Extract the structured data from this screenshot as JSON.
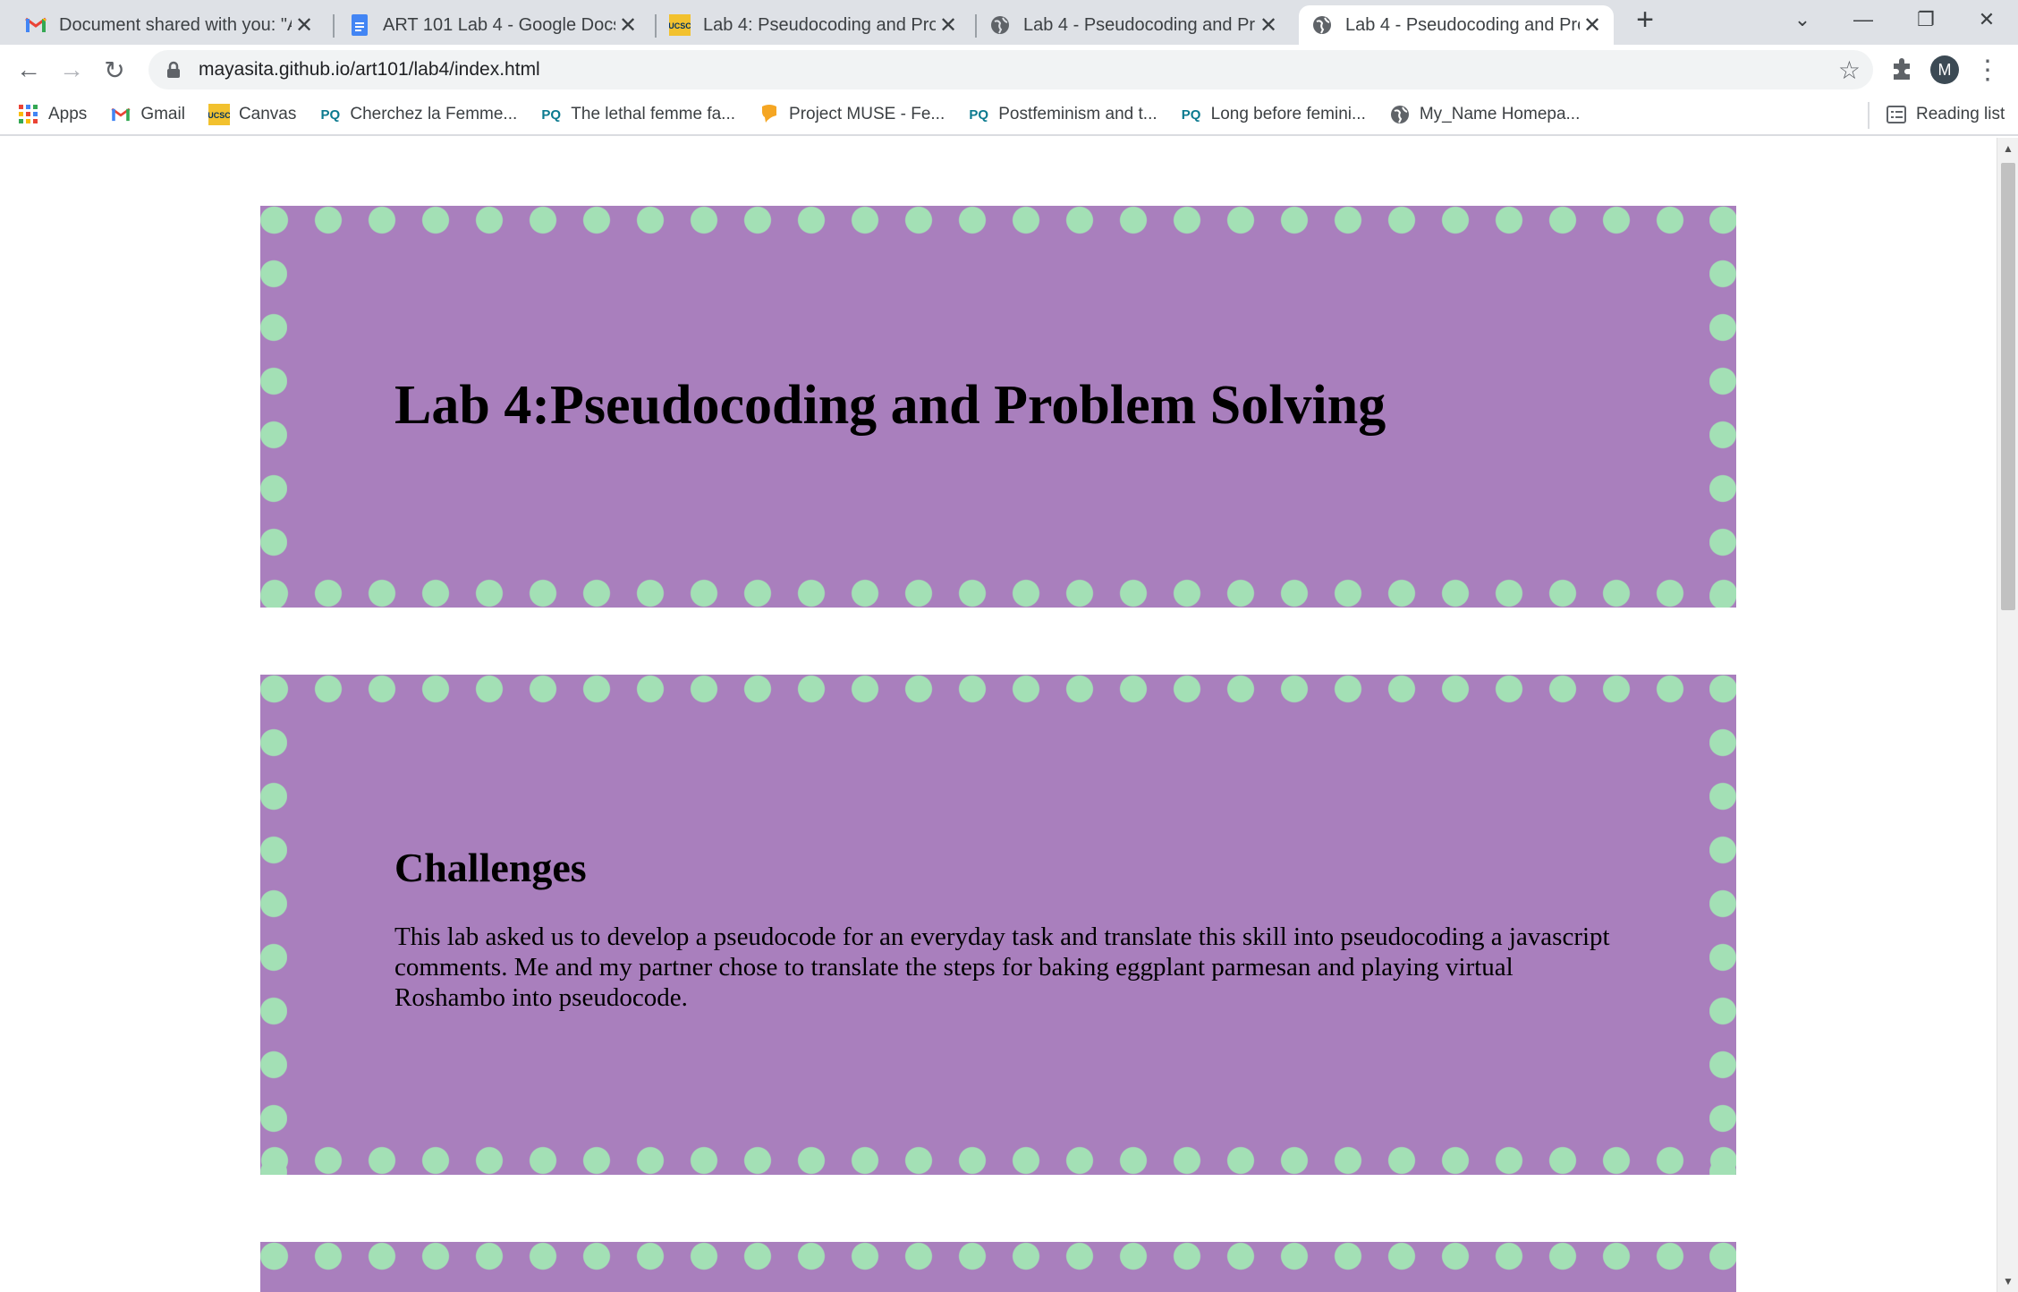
{
  "browser": {
    "tabs": [
      {
        "title": "Document shared with you: \"ART",
        "icon": "gmail-icon"
      },
      {
        "title": "ART 101 Lab 4 - Google Docs",
        "icon": "google-docs-icon"
      },
      {
        "title": "Lab 4: Pseudocoding and Problem",
        "icon": "ucsc-icon"
      },
      {
        "title": "Lab 4 - Pseudocoding and Proble",
        "icon": "globe-icon"
      },
      {
        "title": "Lab 4 - Pseudocoding and Proble",
        "icon": "globe-icon"
      }
    ],
    "active_tab": 4,
    "url": "mayasita.github.io/art101/lab4/index.html",
    "profile_initial": "M",
    "bookmarks": [
      {
        "label": "Apps",
        "icon": "apps-grid-icon"
      },
      {
        "label": "Gmail",
        "icon": "gmail-icon"
      },
      {
        "label": "Canvas",
        "icon": "ucsc-icon"
      },
      {
        "label": "Cherchez la Femme...",
        "icon": "pq-icon"
      },
      {
        "label": "The lethal femme fa...",
        "icon": "pq-icon"
      },
      {
        "label": "Project MUSE - Fe...",
        "icon": "muse-icon"
      },
      {
        "label": "Postfeminism and t...",
        "icon": "pq-icon"
      },
      {
        "label": "Long before femini...",
        "icon": "pq-icon"
      },
      {
        "label": "My_Name Homepa...",
        "icon": "globe-icon"
      }
    ],
    "reading_list": "Reading list",
    "pq_text": "PQ"
  },
  "page": {
    "title": "Lab 4:Pseudocoding and Problem Solving",
    "challenges_heading": "Challenges",
    "challenges_text": "This lab asked us to develop a pseudocode for an everyday task and translate this skill into pseudocoding a javascript comments. Me and my partner chose to translate the steps for baking eggplant parmesan and playing virtual Roshambo into pseudocode."
  },
  "colors": {
    "panel": "#a97fbd",
    "dots": "#a3e0b5"
  }
}
